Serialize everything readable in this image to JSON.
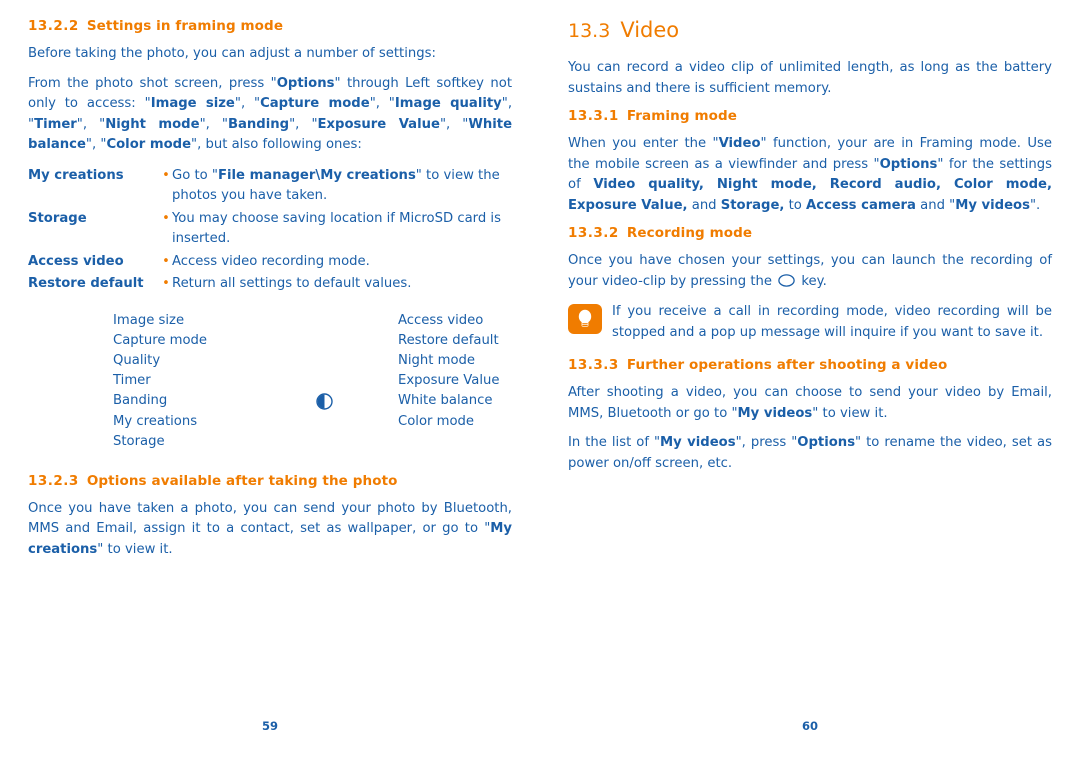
{
  "left": {
    "section1": {
      "number": "13.2.2",
      "title": "Settings in framing mode",
      "para1": "Before taking the photo, you can adjust a number of settings:",
      "para2_parts": [
        {
          "t": "From the photo shot screen, press \"",
          "b": false
        },
        {
          "t": "Options",
          "b": true
        },
        {
          "t": "\" through Left softkey not only to access: \"",
          "b": false
        },
        {
          "t": "Image size",
          "b": true
        },
        {
          "t": "\", \"",
          "b": false
        },
        {
          "t": "Capture mode",
          "b": true
        },
        {
          "t": "\", \"",
          "b": false
        },
        {
          "t": "Image quality",
          "b": true
        },
        {
          "t": "\", \"",
          "b": false
        },
        {
          "t": "Timer",
          "b": true
        },
        {
          "t": "\", \"",
          "b": false
        },
        {
          "t": "Night mode",
          "b": true
        },
        {
          "t": "\", \"",
          "b": false
        },
        {
          "t": "Banding",
          "b": true
        },
        {
          "t": "\", \"",
          "b": false
        },
        {
          "t": "Exposure Value",
          "b": true
        },
        {
          "t": "\", \"",
          "b": false
        },
        {
          "t": "White balance",
          "b": true
        },
        {
          "t": "\", \"",
          "b": false
        },
        {
          "t": "Color mode",
          "b": true
        },
        {
          "t": "\", but also following ones:",
          "b": false
        }
      ],
      "definitions": [
        {
          "term": "My creations",
          "bullet": "•",
          "desc_parts": [
            {
              "t": "Go to \"",
              "b": false
            },
            {
              "t": "File manager\\My creations",
              "b": true
            },
            {
              "t": "\" to view the photos you have taken.",
              "b": false
            }
          ]
        },
        {
          "term": "Storage",
          "bullet": "•",
          "desc_parts": [
            {
              "t": "You may choose saving location if MicroSD card is inserted.",
              "b": false
            }
          ]
        },
        {
          "term": "Access video",
          "bullet": "•",
          "desc_parts": [
            {
              "t": "Access video recording mode.",
              "b": false
            }
          ]
        },
        {
          "term": "Restore default",
          "bullet": "•",
          "desc_parts": [
            {
              "t": "Return all settings to default values.",
              "b": false
            }
          ]
        }
      ],
      "menu_figure": {
        "column1": [
          "Image size",
          "Capture mode",
          "Quality",
          "Timer",
          "Banding",
          "My creations",
          "Storage"
        ],
        "column2": [
          "Access video",
          "Restore default",
          "Night mode",
          "Exposure Value",
          "White balance",
          "Color mode"
        ],
        "indicator_icon": "half-filled-circle-icon"
      }
    },
    "section2": {
      "number": "13.2.3",
      "title": "Options available after taking the photo",
      "para1_parts": [
        {
          "t": "Once you have taken a photo, you can send your photo by Bluetooth, MMS and Email, assign it to a contact, set as wallpaper, or go to \"",
          "b": false
        },
        {
          "t": "My creations",
          "b": true
        },
        {
          "t": "\" to view it.",
          "b": false
        }
      ]
    },
    "page_number": "59"
  },
  "right": {
    "title": {
      "number": "13.3",
      "text": "Video"
    },
    "intro": "You can record a video clip of unlimited length, as long as the battery sustains and there is sufficient memory.",
    "section1": {
      "number": "13.3.1",
      "title": "Framing mode",
      "para1_parts": [
        {
          "t": "When you enter the \"",
          "b": false
        },
        {
          "t": "Video",
          "b": true
        },
        {
          "t": "\" function, your are in Framing mode. Use the mobile screen as a viewfinder and press \"",
          "b": false
        },
        {
          "t": "Options",
          "b": true
        },
        {
          "t": "\" for the settings of ",
          "b": false
        },
        {
          "t": "Video quality, Night mode, Record audio, Color mode, Exposure Value,",
          "b": true
        },
        {
          "t": " and ",
          "b": false
        },
        {
          "t": "Storage,",
          "b": true
        },
        {
          "t": " to ",
          "b": false
        },
        {
          "t": "Access camera",
          "b": true
        },
        {
          "t": " and \"",
          "b": false
        },
        {
          "t": "My videos",
          "b": true
        },
        {
          "t": "\".",
          "b": false
        }
      ]
    },
    "section2": {
      "number": "13.3.2",
      "title": "Recording mode",
      "para1_before": "Once you have chosen your settings, you can launch the recording of your video-clip by pressing the",
      "para1_icon": "record-key-icon",
      "para1_after": "key.",
      "tip": {
        "icon": "tip-lightbulb-icon",
        "text": "If you receive a call in recording mode, video recording will be stopped and a pop up message will inquire if you want to save it."
      }
    },
    "section3": {
      "number": "13.3.3",
      "title": "Further operations after shooting a video",
      "para1_parts": [
        {
          "t": "After shooting a video, you can choose to send your video by Email, MMS, Bluetooth or go to \"",
          "b": false
        },
        {
          "t": "My videos",
          "b": true
        },
        {
          "t": "\" to view it.",
          "b": false
        }
      ],
      "para2_parts": [
        {
          "t": "In the list of \"",
          "b": false
        },
        {
          "t": "My videos",
          "b": true
        },
        {
          "t": "\", press \"",
          "b": false
        },
        {
          "t": "Options",
          "b": true
        },
        {
          "t": "\" to rename the video, set as power on/off screen, etc.",
          "b": false
        }
      ]
    },
    "page_number": "60"
  },
  "colors": {
    "text_blue": "#1b5fa8",
    "heading_orange": "#f07c00",
    "background": "#ffffff"
  }
}
